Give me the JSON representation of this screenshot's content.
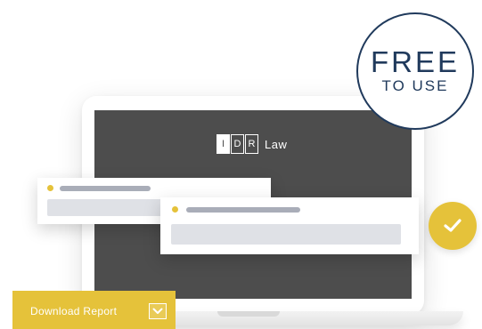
{
  "logo": {
    "letters": [
      "I",
      "D",
      "R"
    ],
    "word": "Law"
  },
  "stamp": {
    "line1": "FREE",
    "line2": "TO USE"
  },
  "cta": {
    "label": "Download Report",
    "icon": "chevron-down-icon"
  },
  "badge": {
    "icon": "checkmark-icon"
  },
  "colors": {
    "accent_yellow": "#e5c23a",
    "navy": "#203a5c",
    "screen": "#4d4d4d",
    "placeholder_line": "#a9adb8",
    "placeholder_bar": "#dfe1e6"
  }
}
